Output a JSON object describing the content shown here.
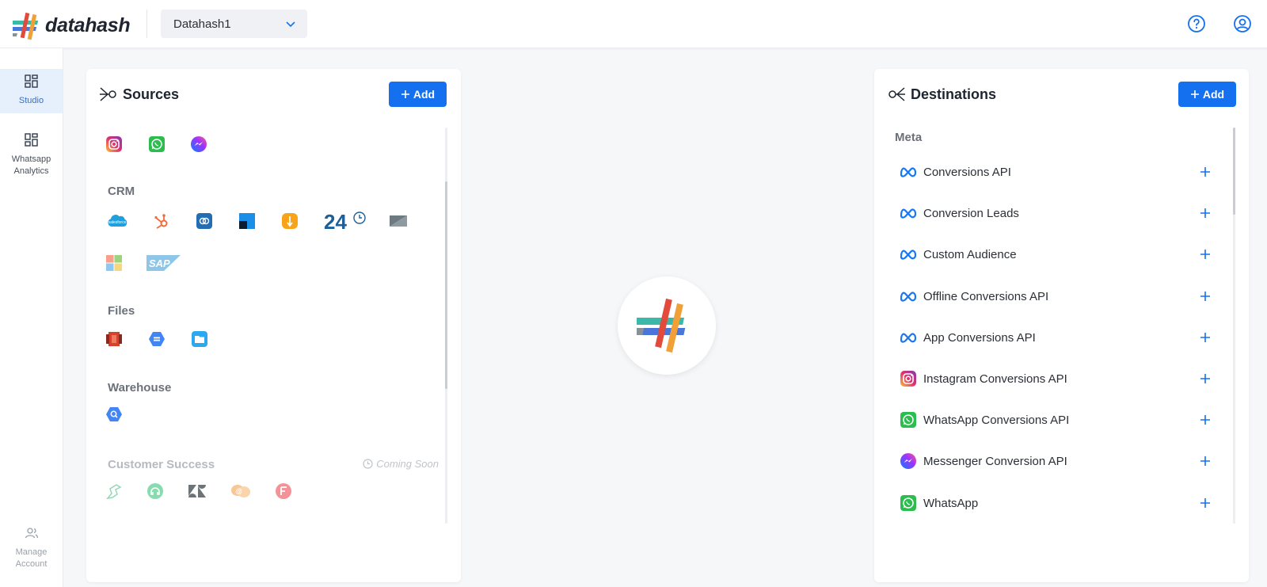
{
  "header": {
    "brand": "datahash",
    "workspace": "Datahash1",
    "icons": [
      "help-icon",
      "account-icon"
    ]
  },
  "nav": {
    "studio": "Studio",
    "whatsapp_analytics": "Whatsapp Analytics",
    "manage_account": "Manage Account"
  },
  "sources": {
    "title": "Sources",
    "add_label": "Add",
    "social": [
      "instagram",
      "whatsapp",
      "messenger"
    ],
    "crm_heading": "CRM",
    "crm": [
      "salesforce",
      "hubspot",
      "zoho",
      "freshsales",
      "pipedrive",
      "bitrix24",
      "zendesk-sell",
      "microsoft-dynamics",
      "sap"
    ],
    "files_heading": "Files",
    "files": [
      "amazon-s3",
      "google-cloud-storage",
      "sftp"
    ],
    "warehouse_heading": "Warehouse",
    "warehouse": [
      "bigquery"
    ],
    "cs_heading": "Customer Success",
    "coming_soon": "Coming Soon",
    "cs": [
      "intercom",
      "freshdesk",
      "zendesk",
      "helpscout",
      "freshchat"
    ]
  },
  "destinations": {
    "title": "Destinations",
    "add_label": "Add",
    "group": "Meta",
    "items": [
      {
        "label": "Conversions API",
        "icon": "meta-icon"
      },
      {
        "label": "Conversion Leads",
        "icon": "meta-icon"
      },
      {
        "label": "Custom Audience",
        "icon": "meta-icon"
      },
      {
        "label": "Offline Conversions API",
        "icon": "meta-icon"
      },
      {
        "label": "App Conversions API",
        "icon": "meta-icon"
      },
      {
        "label": "Instagram Conversions API",
        "icon": "instagram-icon"
      },
      {
        "label": "WhatsApp Conversions API",
        "icon": "whatsapp-icon"
      },
      {
        "label": "Messenger Conversion API",
        "icon": "messenger-icon"
      },
      {
        "label": "WhatsApp",
        "icon": "whatsapp-icon"
      }
    ]
  },
  "colors": {
    "accent": "#1570ef",
    "nav_active_bg": "#e6f0fd",
    "background": "#f6f7f9"
  }
}
